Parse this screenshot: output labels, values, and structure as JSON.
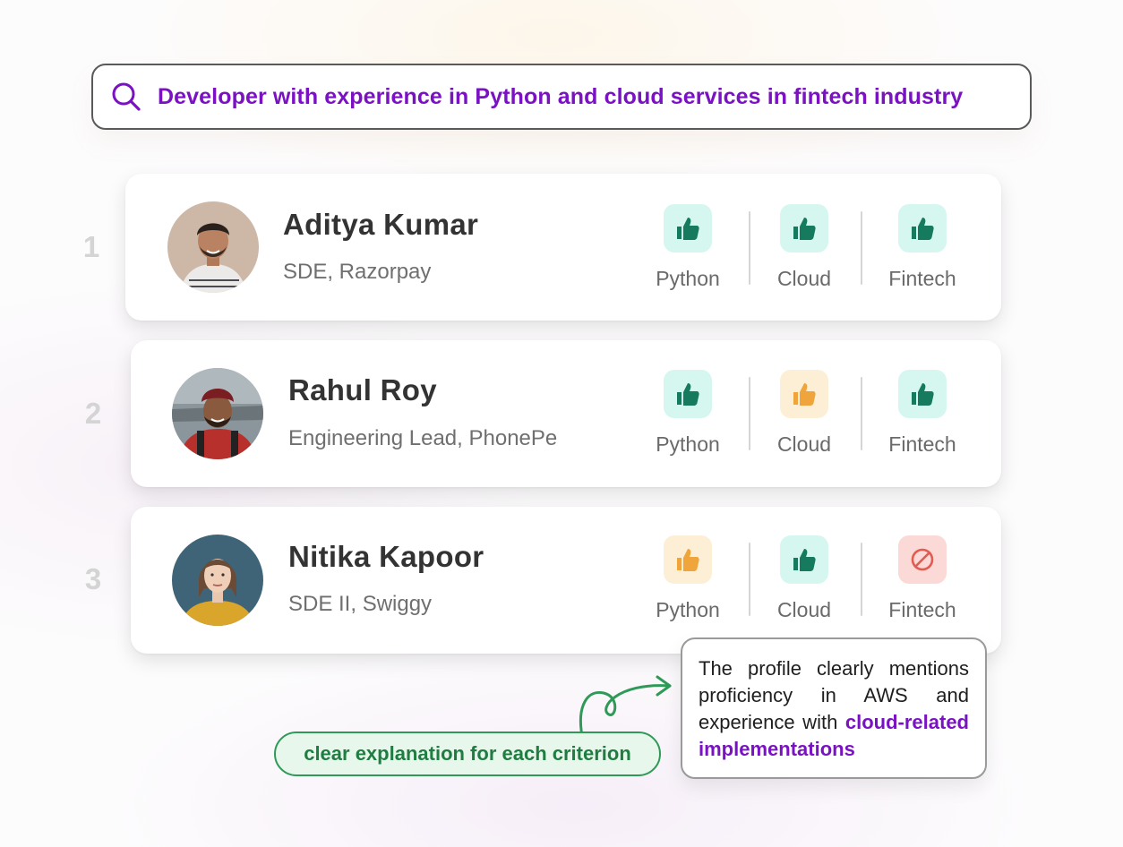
{
  "search": {
    "query": "Developer with experience in Python and cloud services in fintech industry",
    "icon": "search-icon",
    "accent_color": "#7a12c4"
  },
  "candidates": [
    {
      "rank": "1",
      "name": "Aditya Kumar",
      "role": "SDE, Razorpay",
      "criteria": [
        {
          "label": "Python",
          "status": "match",
          "icon": "thumbs-up-icon"
        },
        {
          "label": "Cloud",
          "status": "match",
          "icon": "thumbs-up-icon"
        },
        {
          "label": "Fintech",
          "status": "match",
          "icon": "thumbs-up-icon"
        }
      ]
    },
    {
      "rank": "2",
      "name": "Rahul Roy",
      "role": "Engineering Lead, PhonePe",
      "criteria": [
        {
          "label": "Python",
          "status": "match",
          "icon": "thumbs-up-icon"
        },
        {
          "label": "Cloud",
          "status": "partial",
          "icon": "thumbs-up-icon"
        },
        {
          "label": "Fintech",
          "status": "match",
          "icon": "thumbs-up-icon"
        }
      ]
    },
    {
      "rank": "3",
      "name": "Nitika Kapoor",
      "role": "SDE II, Swiggy",
      "criteria": [
        {
          "label": "Python",
          "status": "partial",
          "icon": "thumbs-up-icon"
        },
        {
          "label": "Cloud",
          "status": "match",
          "icon": "thumbs-up-icon"
        },
        {
          "label": "Fintech",
          "status": "no-match",
          "icon": "prohibited-icon"
        }
      ]
    }
  ],
  "status_colors": {
    "match": {
      "bg": "#d5f7ef",
      "fg": "#157a5e"
    },
    "partial": {
      "bg": "#fdefd6",
      "fg": "#f0a43c"
    },
    "no-match": {
      "bg": "#fad9d6",
      "fg": "#e25b52"
    }
  },
  "annotation": {
    "label": "clear explanation for each criterion",
    "explanation_plain": "The profile clearly mentions proficiency in AWS and experience with ",
    "explanation_highlight": "cloud-related implementations",
    "label_color": "#1f7d42",
    "highlight_color": "#7a12c4"
  }
}
